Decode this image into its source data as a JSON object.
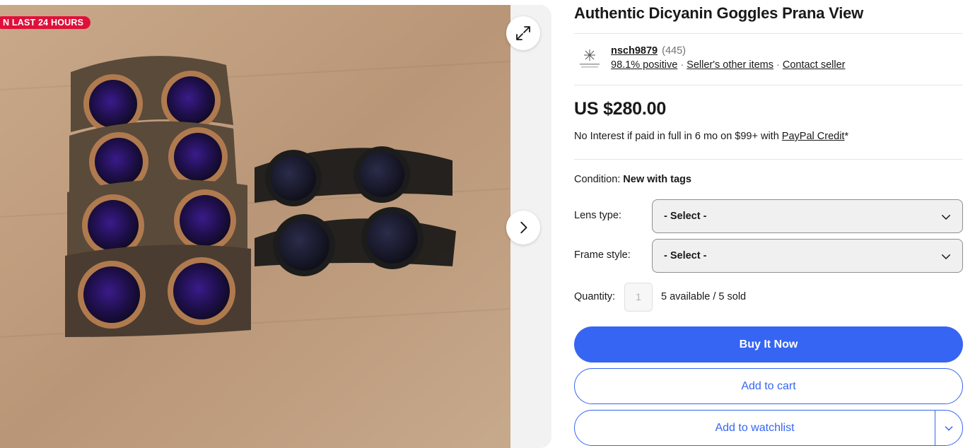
{
  "gallery": {
    "badge": "N LAST 24 HOURS",
    "expand_icon": "expand-arrows-icon",
    "next_icon": "chevron-right-icon",
    "photo_subject": "goggles"
  },
  "listing": {
    "title": "Authentic Dicyanin Goggles Prana View"
  },
  "seller": {
    "name": "nsch9879",
    "feedback_count": "(445)",
    "positive": "98.1% positive",
    "other_items": "Seller's other items",
    "contact": "Contact seller",
    "separator": "·"
  },
  "price": {
    "amount": "US $280.00",
    "credit_text": "No Interest if paid in full in 6 mo on $99+ with ",
    "credit_link": "PayPal Credit",
    "credit_suffix": "*"
  },
  "condition": {
    "label": "Condition:",
    "value": "New with tags"
  },
  "options": {
    "lens_label": "Lens type:",
    "lens_value": "- Select -",
    "frame_label": "Frame style:",
    "frame_value": "- Select -"
  },
  "quantity": {
    "label": "Quantity:",
    "value": "1",
    "availability": "5 available / 5 sold"
  },
  "actions": {
    "buy_now": "Buy It Now",
    "add_to_cart": "Add to cart",
    "add_to_watchlist": "Add to watchlist"
  },
  "colors": {
    "accent": "#3665f3",
    "badge": "#e0103a",
    "text": "#191919",
    "muted": "#707070"
  }
}
